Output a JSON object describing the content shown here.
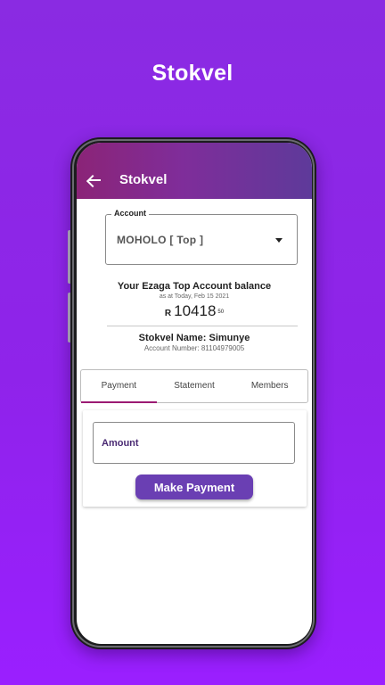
{
  "headline": "Stokvel",
  "appbar": {
    "title": "Stokvel",
    "back_icon": "arrow-left-icon"
  },
  "account": {
    "label": "Account",
    "selected": "MOHOLO [ Top ]",
    "dropdown_icon": "caret-down-icon"
  },
  "balance": {
    "title": "Your Ezaga Top Account balance",
    "as_at": "as at Today, Feb 15 2021",
    "currency": "R",
    "amount": "10418",
    "cents": "50"
  },
  "stokvel": {
    "name_line": "Stokvel  Name: Simunye",
    "account_number": "Account Number: 81104979005"
  },
  "tabs": [
    {
      "label": "Payment",
      "active": true
    },
    {
      "label": "Statement",
      "active": false
    },
    {
      "label": "Members",
      "active": false
    }
  ],
  "payment": {
    "amount_label": "Amount",
    "button_label": "Make Payment"
  },
  "colors": {
    "background": "#8f23ea",
    "appbar_start": "#8b2477",
    "appbar_end": "#5e3a9a",
    "tab_indicator": "#9b1a72",
    "button": "#6a3fb3"
  }
}
